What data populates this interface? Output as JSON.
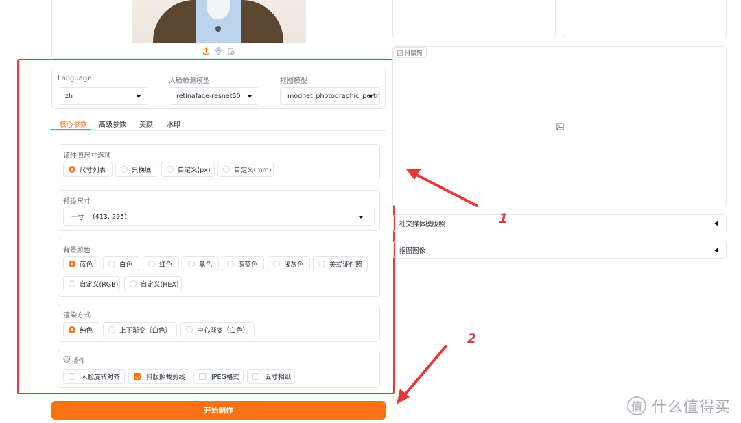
{
  "model_selectors": {
    "language_label": "Language",
    "language_value": "zh",
    "face_detect_label": "人脸检测模型",
    "face_detect_value": "retinaface-resnet50",
    "matting_label": "抠图模型",
    "matting_value": "modnet_photographic_portrait"
  },
  "tabs": [
    "核心参数",
    "高级参数",
    "美颜",
    "水印"
  ],
  "size_option": {
    "label": "证件照尺寸选项",
    "options": [
      "尺寸列表",
      "只换底",
      "自定义(px)",
      "自定义(mm)"
    ],
    "selected": "尺寸列表"
  },
  "preset_size": {
    "label": "预设尺寸",
    "value_name": "一寸",
    "value_dims": "(413, 295)"
  },
  "bg_color": {
    "label": "背景颜色",
    "options": [
      "蓝色",
      "白色",
      "红色",
      "黑色",
      "深蓝色",
      "浅灰色",
      "美式证件照",
      "自定义(RGB)",
      "自定义(HEX)"
    ],
    "selected": "蓝色"
  },
  "render_mode": {
    "label": "渲染方式",
    "options": [
      "纯色",
      "上下渐变（白色）",
      "中心渐变（白色）"
    ],
    "selected": "纯色"
  },
  "plugins": {
    "label": "插件",
    "options": [
      "人脸旋转对齐",
      "排版照裁剪线",
      "JPEG格式",
      "五寸相纸"
    ],
    "checked": [
      "排版照裁剪线"
    ]
  },
  "submit_label": "开始制作",
  "right": {
    "layout_tag": "排版照",
    "accordion_social": "社交媒体模版照",
    "accordion_matting": "抠图图像"
  },
  "annotations": [
    "1",
    "2"
  ],
  "watermark": {
    "logo_char": "值",
    "text": "什么值得买"
  },
  "colors": {
    "accent": "#f97316",
    "highlight_box": "#e63a3a"
  }
}
